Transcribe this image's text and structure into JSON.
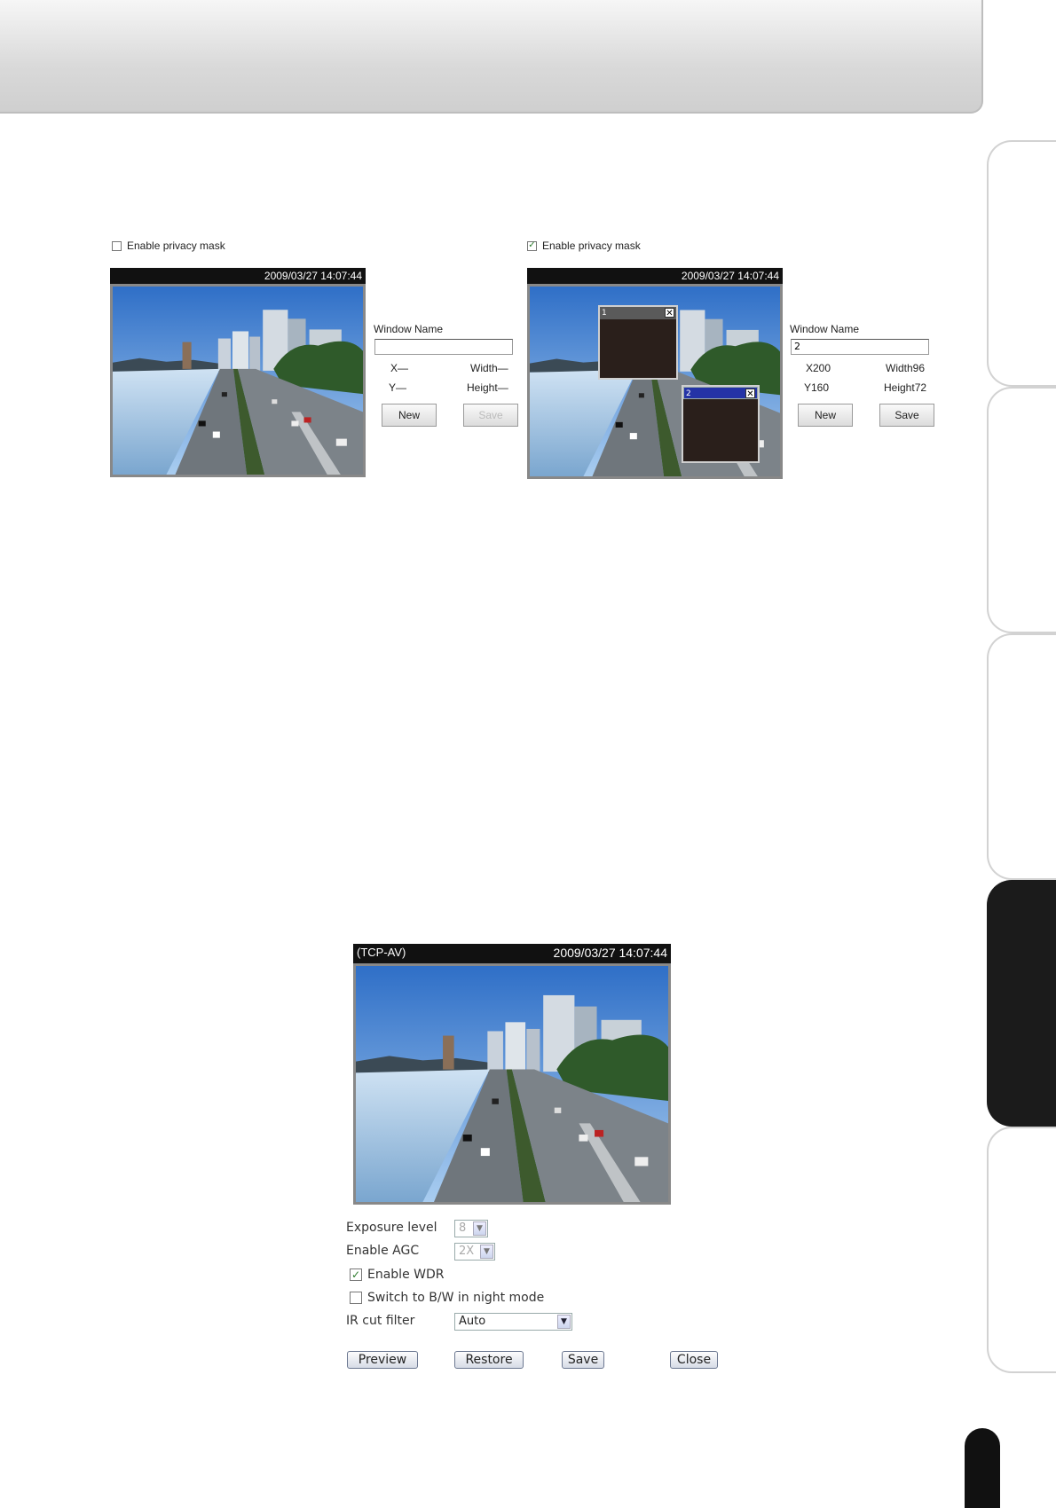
{
  "left_panel": {
    "checkbox_label": "Enable privacy mask",
    "checked": false,
    "timestamp": "2009/03/27 14:07:44",
    "window_name_label": "Window Name",
    "window_name_value": "",
    "x_label": "X—",
    "y_label": "Y—",
    "width_label": "Width—",
    "height_label": "Height—",
    "new_label": "New",
    "save_label": "Save"
  },
  "right_panel": {
    "checkbox_label": "Enable privacy mask",
    "checked": true,
    "timestamp": "2009/03/27 14:07:44",
    "window_name_label": "Window Name",
    "window_name_value": "2",
    "x_label": "X200",
    "y_label": "Y160",
    "width_label": "Width96",
    "height_label": "Height72",
    "new_label": "New",
    "save_label": "Save",
    "mask1_title": "1",
    "mask2_title": "2"
  },
  "bottom_panel": {
    "stream_label": "(TCP-AV)",
    "timestamp": "2009/03/27 14:07:44",
    "exposure_label": "Exposure level",
    "exposure_value": "8",
    "agc_label": "Enable AGC",
    "agc_value": "2X",
    "wdr_label": "Enable WDR",
    "wdr_checked": true,
    "bw_label": "Switch to B/W in night mode",
    "bw_checked": false,
    "ir_label": "IR cut filter",
    "ir_value": "Auto",
    "preview_label": "Preview",
    "restore_label": "Restore",
    "save_label": "Save",
    "close_label": "Close"
  }
}
